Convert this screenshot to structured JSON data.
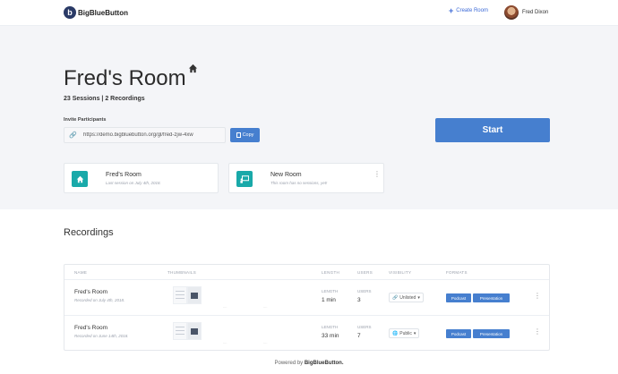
{
  "header": {
    "brand": "BigBlueButton",
    "brand_icon": "bigbluebutton-logo-icon",
    "create_room_label": "Create Room",
    "user_name": "Fred Dixon"
  },
  "hero": {
    "room_title": "Fred's Room",
    "stats": "23 Sessions | 2 Recordings",
    "invite_label": "Invite Participants",
    "invite_url": "https://demo.bigbluebutton.org/gl/fred-zjw-4xw",
    "copy_label": "Copy",
    "start_label": "Start"
  },
  "rooms": [
    {
      "title": "Fred's Room",
      "subtitle": "Last session on July 4th, 2018.",
      "icon": "home-icon"
    },
    {
      "title": "New Room",
      "subtitle": "This room has no sessions, yet!",
      "icon": "chalkboard-icon"
    }
  ],
  "recordings": {
    "heading": "Recordings",
    "columns": [
      "NAME",
      "THUMBNAILS",
      "LENGTH",
      "USERS",
      "VISIBILITY",
      "FORMATS"
    ],
    "rows": [
      {
        "name": "Fred's Room",
        "date": "Recorded on July 4th, 2018.",
        "length_label": "LENGTH",
        "length": "1 min",
        "users_label": "USERS",
        "users": "3",
        "visibility": "Unlisted",
        "visibility_icon": "link-icon",
        "formats": [
          "Podcast",
          "Presentation"
        ]
      },
      {
        "name": "Fred's Room",
        "date": "Recorded on June 14th, 2018.",
        "length_label": "LENGTH",
        "length": "33 min",
        "users_label": "USERS",
        "users": "7",
        "visibility": "Public",
        "visibility_icon": "globe-icon",
        "formats": [
          "Podcast",
          "Presentation"
        ]
      }
    ]
  },
  "footer": {
    "prefix": "Powered by",
    "brand": "BigBlueButton."
  },
  "colors": {
    "primary": "#467fcf",
    "teal": "#19a9a9",
    "hero_bg": "#f4f5f8"
  }
}
